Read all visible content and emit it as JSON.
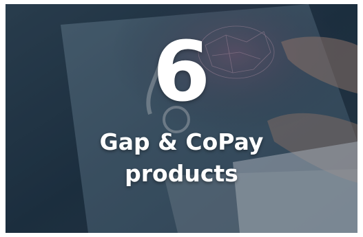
{
  "card": {
    "number": "6",
    "line1": "Gap & CoPay",
    "line2": "products"
  }
}
